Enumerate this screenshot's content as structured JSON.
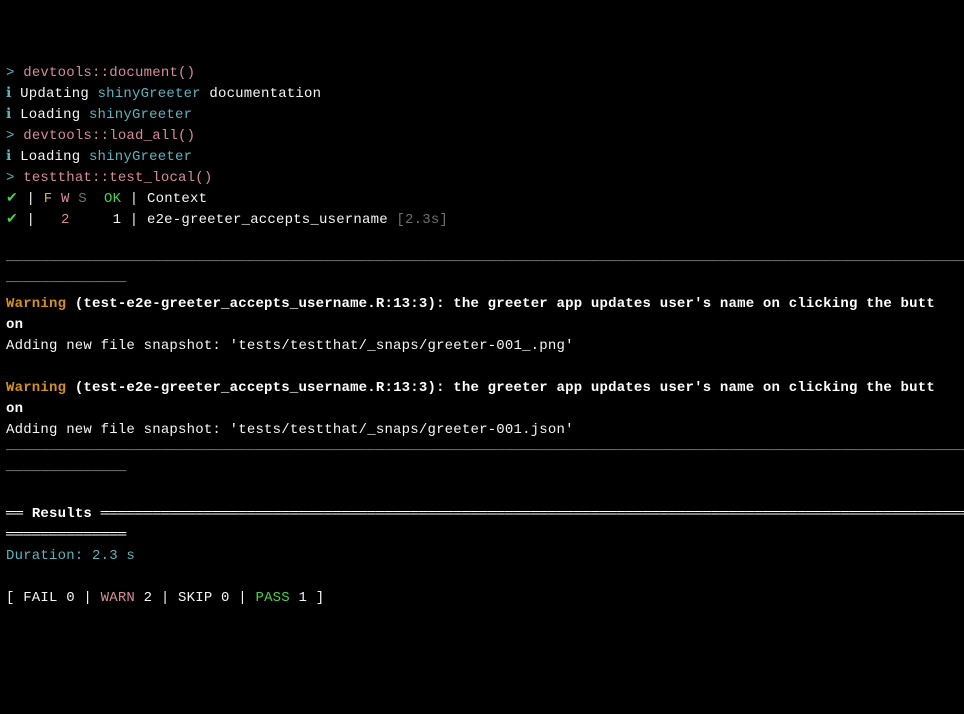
{
  "commands": {
    "prompt": ">",
    "document": "devtools::document()",
    "load_all": "devtools::load_all()",
    "test_local": "testthat::test_local()"
  },
  "status": {
    "info_icon": "ℹ",
    "updating": "Updating ",
    "loading": "Loading ",
    "pkg": "shinyGreeter",
    "documentation_suffix": " documentation"
  },
  "header": {
    "check": "✔",
    "sep": " | ",
    "F": "F",
    "W": "W",
    "S": "S",
    "OK": "OK",
    "context": " | Context"
  },
  "result_row": {
    "check": "✔",
    "pre": " |   ",
    "warn_count": "2",
    "mid": "     1 | e2e-greeter_accepts_username ",
    "time": "[2.3s]"
  },
  "rules": {
    "long1": "──────────────────────────────────────────────────────────────────────────────────────────────────────────────────",
    "short1": "──────────────",
    "results_prefix": "══ ",
    "results_label": "Results",
    "results_long": " ═════════════════════════════════════════════════════════════════════════════════════════════════════════",
    "results_short": "══════════════"
  },
  "warnings": [
    {
      "tag": "Warning",
      "loc": " (test-e2e-greeter_accepts_username.R:13:3): the greeter app updates user's name on clicking the butt",
      "cont": "on",
      "msg": "Adding new file snapshot: 'tests/testthat/_snaps/greeter-001_.png'"
    },
    {
      "tag": "Warning",
      "loc": " (test-e2e-greeter_accepts_username.R:13:3): the greeter app updates user's name on clicking the butt",
      "cont": "on",
      "msg": "Adding new file snapshot: 'tests/testthat/_snaps/greeter-001.json'"
    }
  ],
  "summary": {
    "duration": "Duration: 2.3 s",
    "open": "[ ",
    "fail": "FAIL",
    "fail_n": " 0 | ",
    "warn": "WARN",
    "warn_n": " 2 | ",
    "skip": "SKIP",
    "skip_n": " 0 | ",
    "pass": "PASS",
    "pass_n": " 1 ",
    "close": "]"
  }
}
